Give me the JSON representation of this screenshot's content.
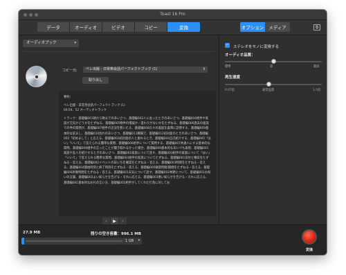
{
  "window": {
    "title": "Toast 16 Pro"
  },
  "main_tabs": [
    {
      "label": "データ",
      "active": false
    },
    {
      "label": "オーディオ",
      "active": false
    },
    {
      "label": "ビデオ",
      "active": false
    },
    {
      "label": "コピー",
      "active": false
    },
    {
      "label": "変換",
      "active": true
    }
  ],
  "side_tabs": [
    {
      "label": "オプション",
      "active": true
    },
    {
      "label": "メディア",
      "active": false
    }
  ],
  "left": {
    "format_dropdown": "オーディオブック",
    "copy_label": "コピー元:",
    "copy_source": "ベレ出版 - 日常英会話パーフェクトブック (1)",
    "eject_label": "取り出し",
    "summary": {
      "heading": "要約：",
      "line1": "ベレ出版 - 日常英会話パーフェクトブック (1)",
      "line2": "69:59、52 オーディオトラック",
      "body": "トラック：基礎編001朝から晩までのあいさつ、基礎編002人に会ったときのあいさつ、基礎編004相手や家族が元気かどうかをたずねる、基礎編005物件の増減か・変わりがないかをたずねる、基礎編006過去の面談での件の質問が、基礎編007相手の近況を無いたる、基礎編008久々の面談を喜興に説明する、基礎編009基本的な前まし、基礎編010別れのあいさつ、基礎編011職場で、基礎編012初対面のときのあいさつ、基礎編002「初めまして」と応える、基礎編003初対面の人と挨れるとき、基礎編004自己紹介する、基礎編005「はい」「いいえ」で答えられる簡単な質問、基礎編006相手について質問する、基礎編007共通人にする基本的な質問、基礎編008相手の言ったことが聞き取れなかった場合、基礎編009基本的なあいづち表現、基礎編001家族や友人を紹介するときのあいさつ、基礎編002家族について話す、基礎編003相手の家族について「はい」「いいえ」で答えられる簡単な質問、基礎編004相手の家族についてたずねる、基礎編001日付と曜日をたずねる・答える、基礎編002イベントの日にちを確認をたずねる・答える、基礎編003時間をたずねる・答える、基礎編004開始時刻と終了時刻をたずねる・答える、基礎編005継続時間/期間をたずねる・答える、基礎編006所要時間をたずねる・答える、基礎編001天気について話す、基礎編002季節について、基礎編001お祝いの言葉、基礎編002よい知らせを告げる・それに応える、基礎編003悪い知らせを告げる・それに応える、基礎編001基本的なお礼の言い方、基礎編002相手がしてくれた行為に対してお"
    },
    "pager": {
      "prev": "‹",
      "play": "▶",
      "next": "›"
    }
  },
  "right": {
    "stereo_checked": true,
    "stereo_label": "ステレオをモノに変換する",
    "audio_quality": {
      "title": "オーディオ品質：",
      "level": 0.5,
      "labels": [
        "標準",
        "高",
        "最高"
      ]
    },
    "playback_speed": {
      "title": "再生速度",
      "level": 0.45,
      "labels": [
        "0.67倍",
        "通常品質",
        "1.5倍"
      ]
    }
  },
  "bottom": {
    "size": "27.9 MB",
    "free_space": "残りの空き容量：996.1 MB",
    "capacity": "1 GB",
    "capacity_fill": 0.03,
    "convert_label": "変換"
  },
  "colors": {
    "accent": "#2b8ff5",
    "convert": "#d8230e"
  }
}
